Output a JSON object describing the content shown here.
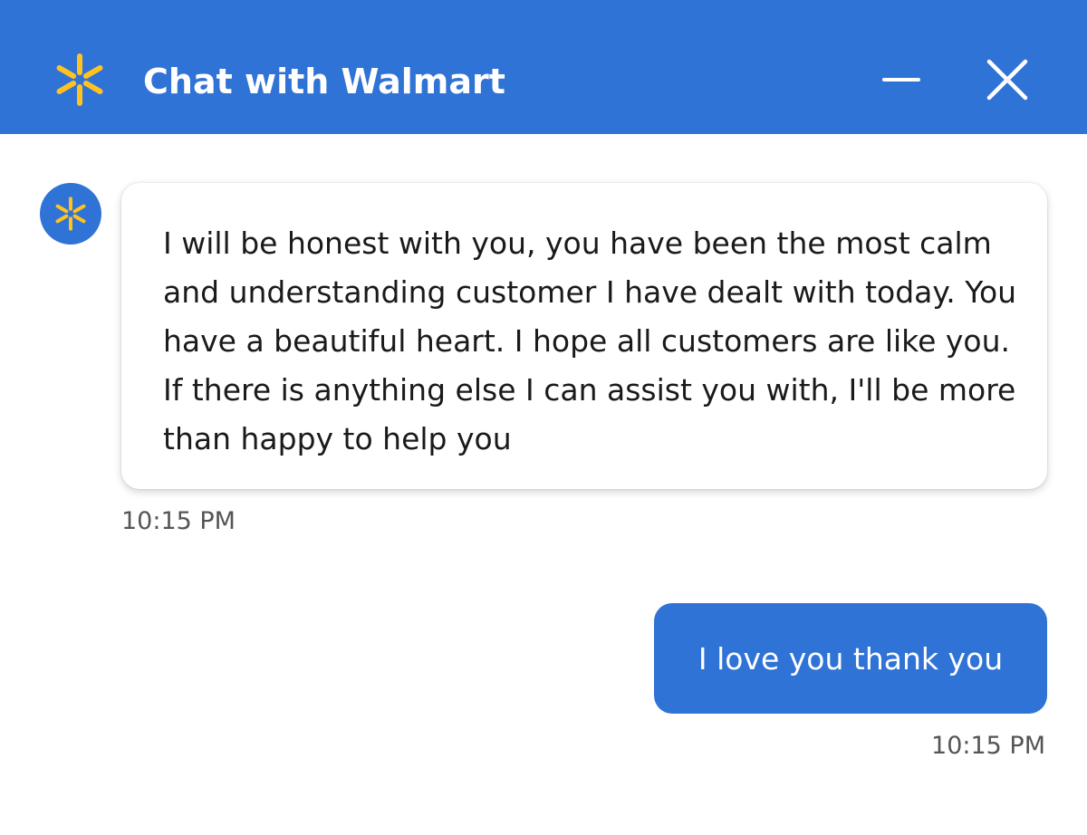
{
  "colors": {
    "brand_blue": "#3073d6",
    "spark_yellow": "#ffc220",
    "white": "#ffffff",
    "timestamp_gray": "#555555"
  },
  "header": {
    "logo_icon": "walmart-spark-icon",
    "title": "Chat with Walmart",
    "minimize_icon": "minimize-icon",
    "close_icon": "close-icon"
  },
  "messages": [
    {
      "sender": "agent",
      "avatar_icon": "walmart-spark-icon",
      "text": "I will be honest with you, you have been the most calm and understanding customer I have dealt with today. You have a beautiful heart. I hope all customers are like you. If there is anything else I can assist you with, I'll be more than happy to help you",
      "time": "10:15 PM"
    },
    {
      "sender": "user",
      "text": "I love you thank you",
      "time": "10:15 PM"
    }
  ]
}
